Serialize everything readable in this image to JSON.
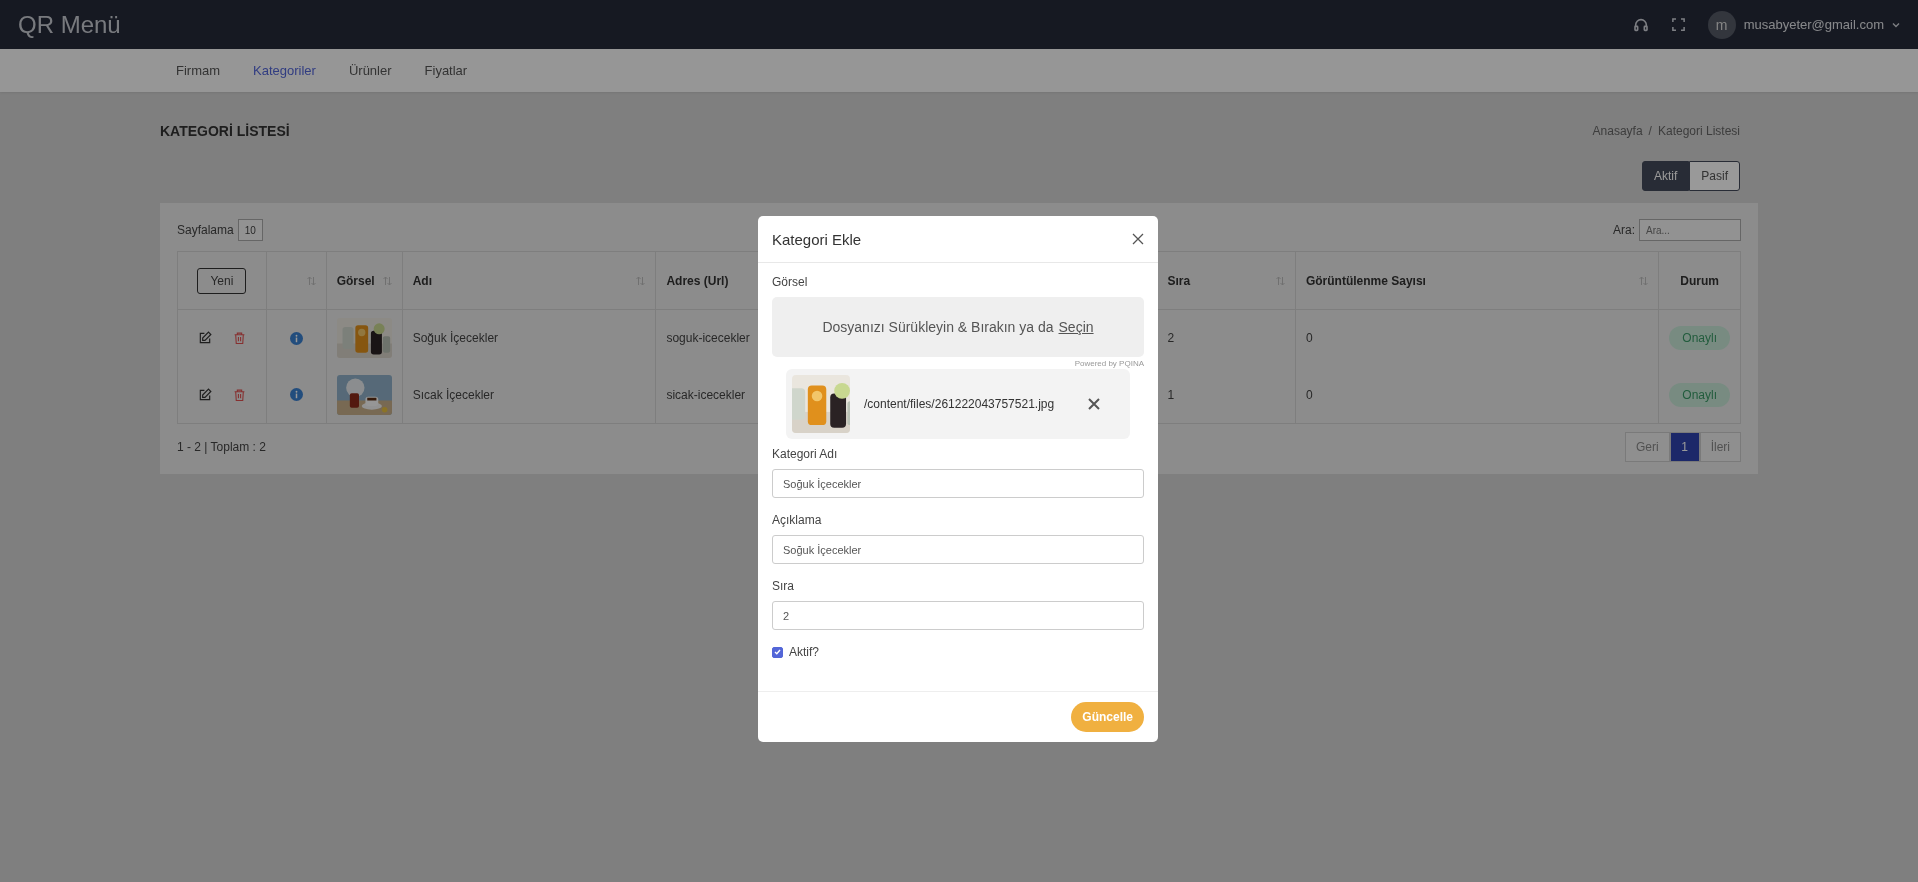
{
  "app": {
    "title": "QR Menü",
    "user": {
      "avatar_letter": "m",
      "email": "musabyeter@gmail.com"
    }
  },
  "nav": [
    {
      "label": "Firmam",
      "selected": false
    },
    {
      "label": "Kategoriler",
      "selected": true
    },
    {
      "label": "Ürünler",
      "selected": false
    },
    {
      "label": "Fiyatlar",
      "selected": false
    }
  ],
  "page": {
    "title": "KATEGORİ LİSTESİ",
    "breadcrumb": [
      "Anasayfa",
      "Kategori Listesi"
    ],
    "breadcrumb_separator": "/"
  },
  "filter_toggle": [
    {
      "label": "Aktif",
      "selected": true
    },
    {
      "label": "Pasif",
      "selected": false
    }
  ],
  "table": {
    "page_size_label": "Sayfalama",
    "page_size": "10",
    "search_label": "Ara:",
    "search_placeholder": "Ara...",
    "new_button": "Yeni",
    "columns": [
      "Görsel",
      "Adı",
      "Adres (Url)",
      "Sıra",
      "Görüntülenme Sayısı",
      "Durum"
    ],
    "rows": [
      {
        "name": "Soğuk İçecekler",
        "url": "soguk-icecekler",
        "order": "2",
        "views": "0",
        "status": "Onaylı"
      },
      {
        "name": "Sıcak İçecekler",
        "url": "sicak-icecekler",
        "order": "1",
        "views": "0",
        "status": "Onaylı"
      }
    ],
    "summary": "1 - 2 | Toplam : 2",
    "pagination": {
      "prev": "Geri",
      "pages": [
        {
          "label": "1",
          "selected": true
        }
      ],
      "next": "İleri"
    }
  },
  "modal": {
    "title": "Kategori Ekle",
    "upload": {
      "label": "Görsel",
      "drop_text": "Dosyanızı Sürükleyin & Bırakın ya da",
      "drop_link": "Seçin",
      "credit": "Powered by PQINA",
      "file": {
        "path": "/content/files/261222043757521.jpg"
      }
    },
    "fields": [
      {
        "label": "Kategori Adı",
        "value": "Soğuk İçecekler"
      },
      {
        "label": "Açıklama",
        "value": "Soğuk İçecekler"
      },
      {
        "label": "Sıra",
        "value": "2"
      }
    ],
    "checkbox": {
      "label": "Aktif?",
      "checked": true
    },
    "submit": "Güncelle"
  }
}
